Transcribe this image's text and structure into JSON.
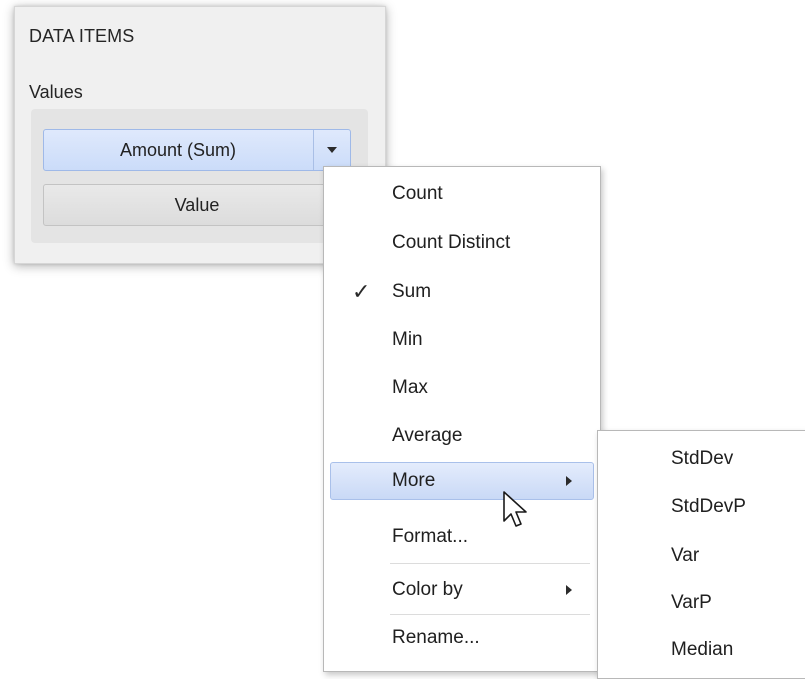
{
  "panel": {
    "header": "DATA ITEMS",
    "group_label": "Values",
    "items": [
      {
        "label": "Amount (Sum)"
      },
      {
        "label": "Value"
      }
    ]
  },
  "context_menu": {
    "items": [
      {
        "label": "Count"
      },
      {
        "label": "Count Distinct"
      },
      {
        "label": "Sum",
        "checked": true
      },
      {
        "label": "Min"
      },
      {
        "label": "Max"
      },
      {
        "label": "Average"
      },
      {
        "label": "More",
        "has_submenu": true,
        "highlighted": true
      },
      {
        "label": "Format..."
      },
      {
        "label": "Color by",
        "has_submenu": true
      },
      {
        "label": "Rename..."
      }
    ],
    "check_mark": "✓"
  },
  "more_submenu": {
    "items": [
      {
        "label": "StdDev"
      },
      {
        "label": "StdDevP"
      },
      {
        "label": "Var"
      },
      {
        "label": "VarP"
      },
      {
        "label": "Median"
      }
    ]
  },
  "colors": {
    "panel_bg": "#f0f0f0",
    "active_item_bg": "#cbdcf9",
    "highlight_bg": "#c9d9f6",
    "menu_bg": "#ffffff"
  }
}
